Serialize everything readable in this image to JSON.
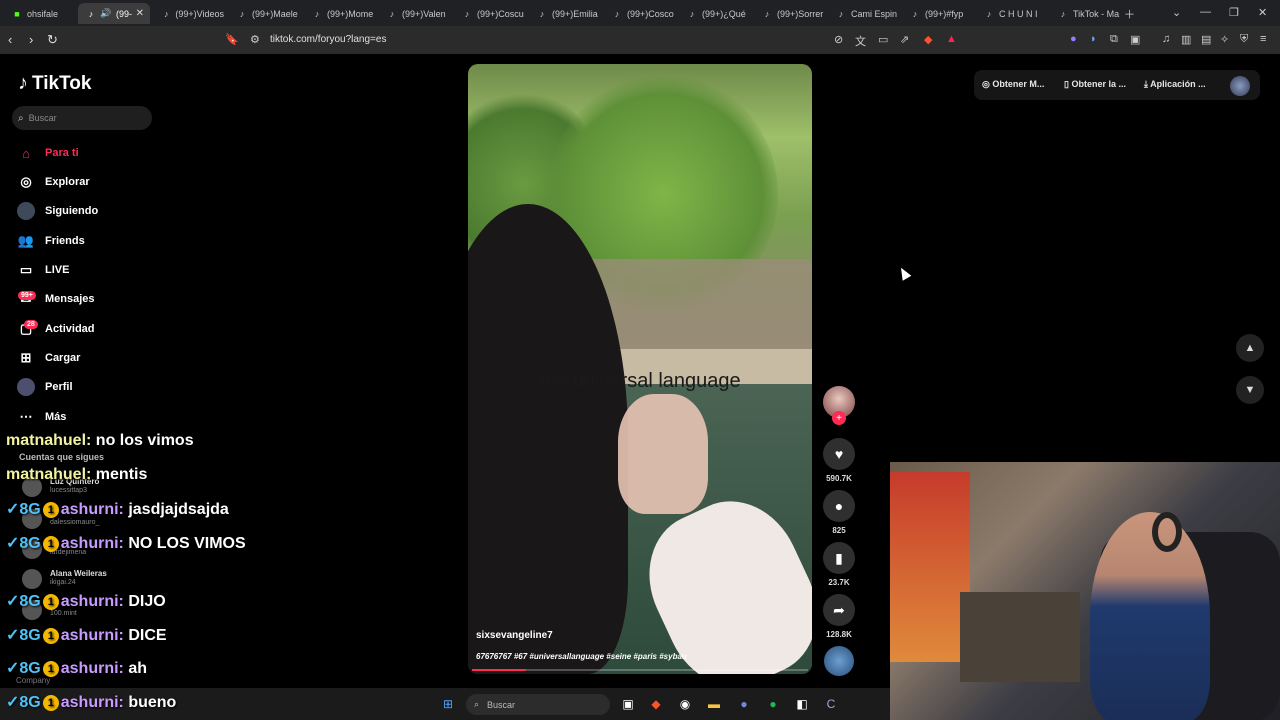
{
  "browser": {
    "tabs": [
      {
        "label": "ohsifale",
        "icon": "kick-icon"
      },
      {
        "label": "(99-",
        "icon": "tiktok-icon",
        "active": true
      },
      {
        "label": "(99+)Videos",
        "icon": "tiktok-icon"
      },
      {
        "label": "(99+)Maele",
        "icon": "tiktok-icon"
      },
      {
        "label": "(99+)Mome",
        "icon": "tiktok-icon"
      },
      {
        "label": "(99+)Valen",
        "icon": "tiktok-icon"
      },
      {
        "label": "(99+)Coscu",
        "icon": "tiktok-icon"
      },
      {
        "label": "(99+)Emilia",
        "icon": "tiktok-icon"
      },
      {
        "label": "(99+)Cosco",
        "icon": "tiktok-icon"
      },
      {
        "label": "(99+)¿Qué",
        "icon": "tiktok-icon"
      },
      {
        "label": "(99+)Sorrer",
        "icon": "tiktok-icon"
      },
      {
        "label": "Cami Espin",
        "icon": "tiktok-icon"
      },
      {
        "label": "(99+)#fyp",
        "icon": "tiktok-icon"
      },
      {
        "label": "C H U N I",
        "icon": "tiktok-icon"
      },
      {
        "label": "TikTok - Ma",
        "icon": "tiktok-icon"
      }
    ],
    "url": "tiktok.com/foryou?lang=es"
  },
  "sidebar": {
    "logo": "TikTok",
    "search_placeholder": "Buscar",
    "items": [
      {
        "label": "Para ti",
        "icon": "home-icon"
      },
      {
        "label": "Explorar",
        "icon": "compass-icon"
      },
      {
        "label": "Siguiendo",
        "icon": "following-avatar-icon"
      },
      {
        "label": "Friends",
        "icon": "friends-icon"
      },
      {
        "label": "LIVE",
        "icon": "live-tv-icon"
      },
      {
        "label": "Mensajes",
        "icon": "messages-icon",
        "badge": "99+"
      },
      {
        "label": "Actividad",
        "icon": "activity-icon",
        "badge": "28"
      },
      {
        "label": "Cargar",
        "icon": "upload-icon"
      },
      {
        "label": "Perfil",
        "icon": "profile-icon"
      },
      {
        "label": "Más",
        "icon": "more-icon"
      }
    ],
    "following_title": "Cuentas que sigues",
    "accounts": [
      {
        "name": "Luz Quintero",
        "handle": "lucessittap3"
      },
      {
        "name": "",
        "handle": "dalessiomauro_"
      },
      {
        "name": "",
        "handle": "lurdejimena"
      },
      {
        "name": "Alana Weileras",
        "handle": "ikigai.24"
      },
      {
        "name": "",
        "handle": "100.mint"
      }
    ],
    "footer": "Company"
  },
  "video": {
    "overlay_text": "the universal language",
    "username": "sixsevangeline7",
    "caption": "67676767 #67 #universallanguage #seine #paris #sybau",
    "progress": 0.16
  },
  "actions": {
    "likes": "590.7K",
    "comments": "825",
    "saves": "23.7K",
    "shares": "128.8K"
  },
  "top_buttons": {
    "coins": "Obtener M...",
    "app": "Obtener la ...",
    "download": "Aplicación ..."
  },
  "chat": [
    {
      "user": "matnahuel:",
      "message": "no los vimos",
      "style": "plain"
    },
    {
      "user": "matnahuel:",
      "message": "mentis",
      "style": "plain"
    },
    {
      "user": "ashurni:",
      "message": "jasdjajdsajda",
      "style": "badged"
    },
    {
      "user": "ashurni:",
      "message": "NO LOS VIMOS",
      "style": "badged"
    },
    {
      "user": "ashurni:",
      "message": "DIJO",
      "style": "badged"
    },
    {
      "user": "ashurni:",
      "message": "DICE",
      "style": "badged"
    },
    {
      "user": "ashurni:",
      "message": "ah",
      "style": "badged"
    },
    {
      "user": "ashurni:",
      "message": "bueno",
      "style": "badged"
    }
  ],
  "chat_badge": {
    "glyph": "✓",
    "tag": "8G",
    "coin": "1"
  },
  "taskbar": {
    "search_placeholder": "Buscar"
  },
  "colors": {
    "accent": "#fe2c55",
    "bg": "#000000",
    "chat_user_badged": "#c79bff",
    "chat_user_plain": "#f2f2a0"
  }
}
